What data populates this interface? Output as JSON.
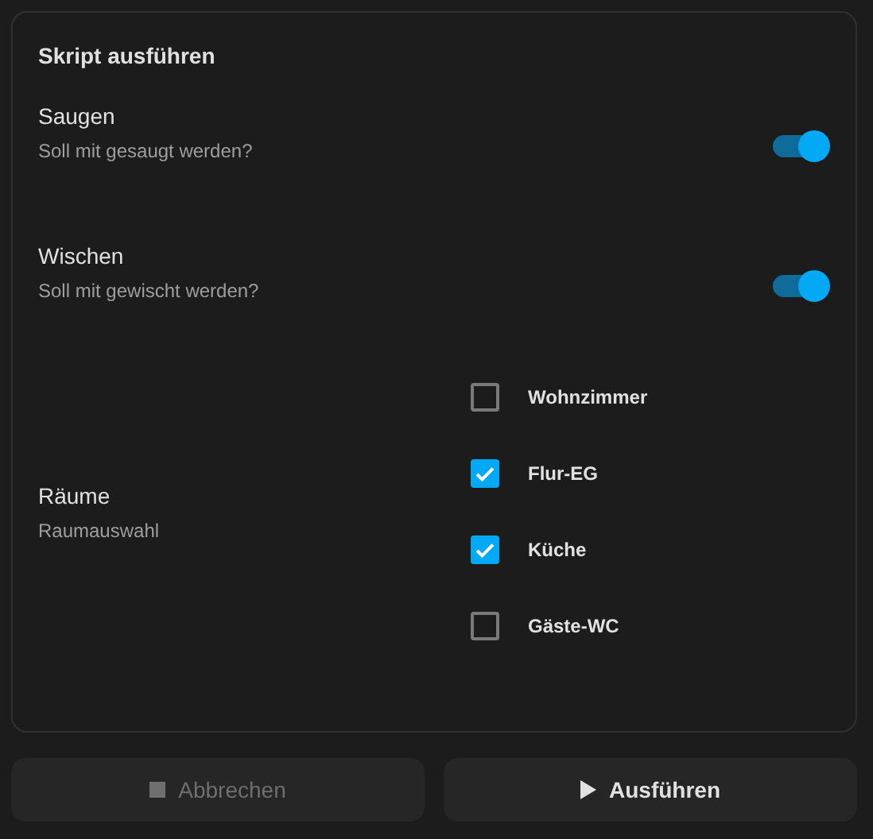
{
  "card": {
    "title": "Skript ausführen",
    "fields": [
      {
        "kind": "toggle",
        "label": "Saugen",
        "description": "Soll mit gesaugt werden?",
        "on": true
      },
      {
        "kind": "toggle",
        "label": "Wischen",
        "description": "Soll mit gewischt werden?",
        "on": true
      },
      {
        "kind": "checklist",
        "label": "Räume",
        "description": "Raumauswahl",
        "options": [
          {
            "label": "Wohnzimmer",
            "checked": false
          },
          {
            "label": "Flur-EG",
            "checked": true
          },
          {
            "label": "Küche",
            "checked": true
          },
          {
            "label": "Gäste-WC",
            "checked": false
          }
        ]
      }
    ]
  },
  "buttons": [
    {
      "kind": "stop",
      "label": "Abbrechen",
      "disabled": true
    },
    {
      "kind": "run",
      "label": "Ausführen",
      "disabled": false
    }
  ]
}
